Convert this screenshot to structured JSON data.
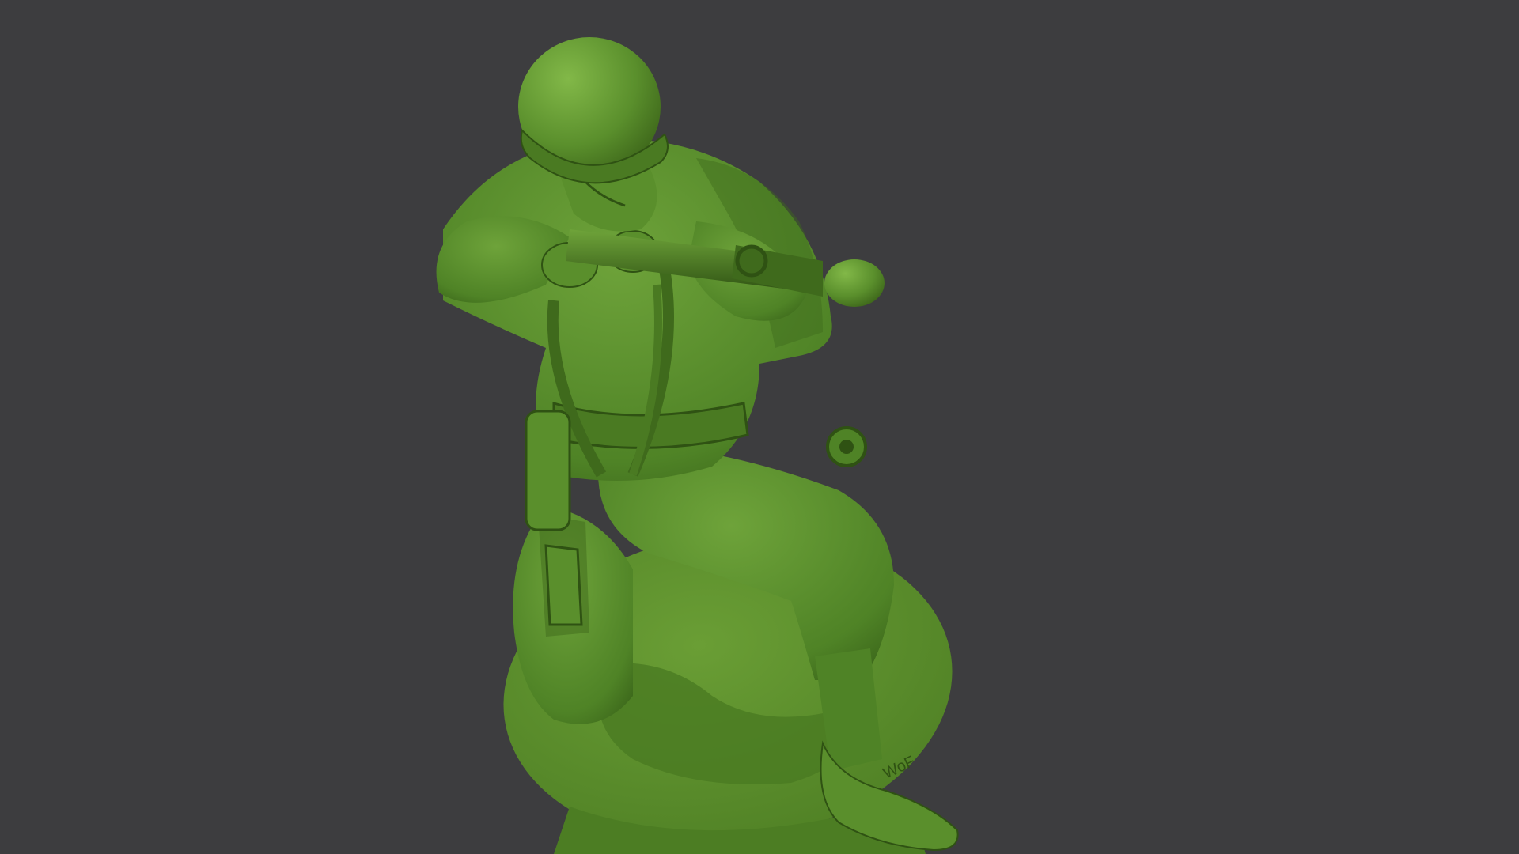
{
  "viewport": {
    "background_color": "#3d3d3f"
  },
  "subject": {
    "icon": "kneeling-soldier-figurine",
    "colors": {
      "plastic_base": "#5a8f2c",
      "plastic_light": "#74a83c",
      "plastic_shadow": "#3f6a1c",
      "plastic_deep": "#2f5213",
      "base_disc": "#5d8f2d",
      "base_shadow": "#4a7a22"
    }
  },
  "detail_text": {
    "boot_marking": "WoF"
  }
}
